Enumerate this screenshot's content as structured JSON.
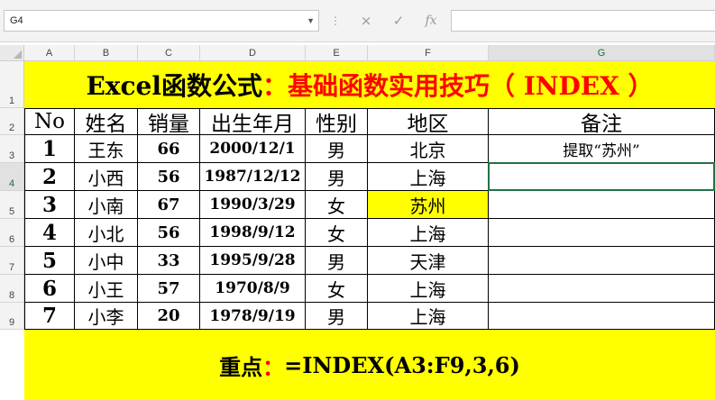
{
  "formula_bar": {
    "name_box": "G4",
    "cancel_icon": "×",
    "enter_icon": "✓",
    "fx_label": "fx",
    "formula": ""
  },
  "columns": [
    "A",
    "B",
    "C",
    "D",
    "E",
    "F",
    "G"
  ],
  "rows": [
    "1",
    "2",
    "3",
    "4",
    "5",
    "6",
    "7",
    "8",
    "9"
  ],
  "title": {
    "part1": "Excel函数公式",
    "part2": "：基础函数实用技巧（ INDEX ）"
  },
  "table": {
    "headers": [
      "No",
      "姓名",
      "销量",
      "出生年月",
      "性别",
      "地区",
      "备注"
    ],
    "records": [
      [
        "1",
        "王东",
        "66",
        "2000/12/1",
        "男",
        "北京",
        "提取“苏州”"
      ],
      [
        "2",
        "小西",
        "56",
        "1987/12/12",
        "男",
        "上海",
        ""
      ],
      [
        "3",
        "小南",
        "67",
        "1990/3/29",
        "女",
        "苏州",
        ""
      ],
      [
        "4",
        "小北",
        "56",
        "1998/9/12",
        "女",
        "上海",
        ""
      ],
      [
        "5",
        "小中",
        "33",
        "1995/9/28",
        "男",
        "天津",
        ""
      ],
      [
        "6",
        "小王",
        "57",
        "1970/8/9",
        "女",
        "上海",
        ""
      ],
      [
        "7",
        "小李",
        "20",
        "1978/9/19",
        "男",
        "上海",
        ""
      ]
    ]
  },
  "footer": {
    "part1": "重点",
    "part2": "：",
    "part3": "=INDEX(A3:F9,3,6)"
  },
  "colors": {
    "highlight_yellow": "#ffff00",
    "title_red": "#ff0000",
    "selection_green": "#217346"
  }
}
